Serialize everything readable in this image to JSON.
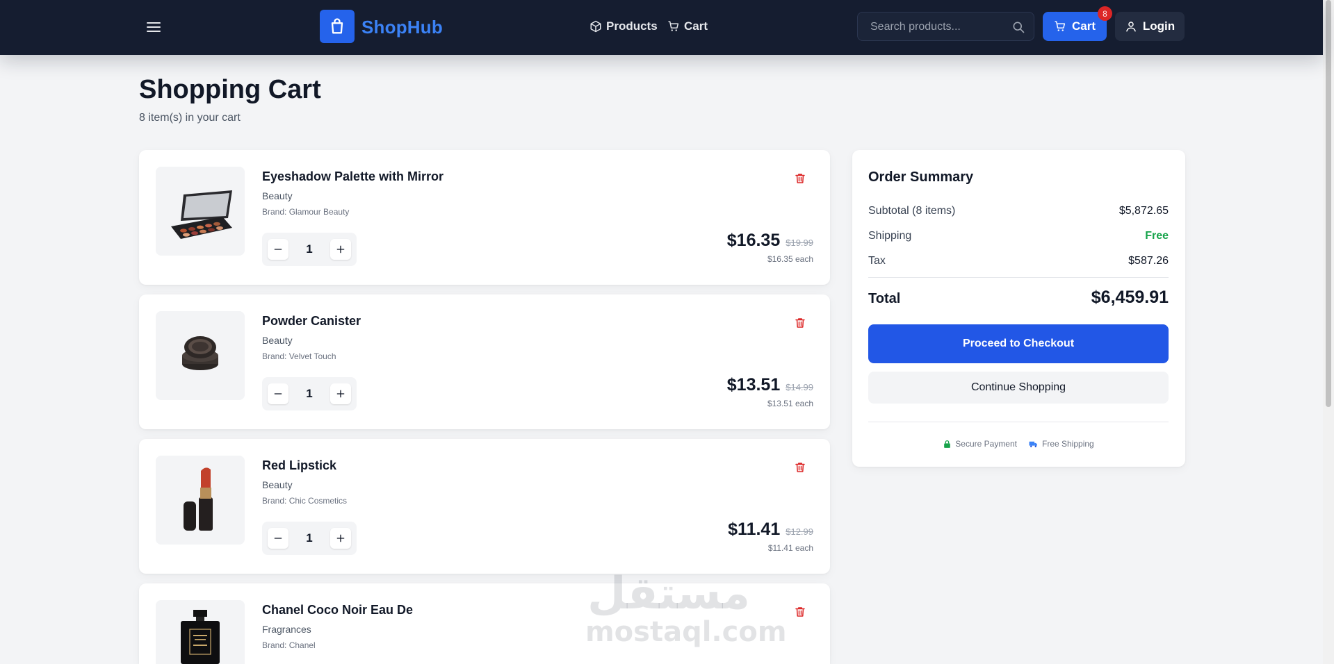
{
  "brand": {
    "name": "ShopHub"
  },
  "nav": {
    "menu_icon": "hamburger-menu-icon",
    "products_label": "Products",
    "cart_label": "Cart",
    "search_placeholder": "Search products...",
    "cart_button_label": "Cart",
    "cart_count": "8",
    "login_label": "Login"
  },
  "page": {
    "title": "Shopping Cart",
    "subtitle": "8 item(s) in your cart"
  },
  "cart_items": [
    {
      "name": "Eyeshadow Palette with Mirror",
      "category": "Beauty",
      "brand": "Brand: Glamour Beauty",
      "quantity": "1",
      "price": "$16.35",
      "original_price": "$19.99",
      "each": "$16.35 each"
    },
    {
      "name": "Powder Canister",
      "category": "Beauty",
      "brand": "Brand: Velvet Touch",
      "quantity": "1",
      "price": "$13.51",
      "original_price": "$14.99",
      "each": "$13.51 each"
    },
    {
      "name": "Red Lipstick",
      "category": "Beauty",
      "brand": "Brand: Chic Cosmetics",
      "quantity": "1",
      "price": "$11.41",
      "original_price": "$12.99",
      "each": "$11.41 each"
    },
    {
      "name": "Chanel Coco Noir Eau De",
      "category": "Fragrances",
      "brand": "Brand: Chanel",
      "quantity": "",
      "price": "",
      "original_price": "",
      "each": ""
    }
  ],
  "summary": {
    "title": "Order Summary",
    "subtotal_label": "Subtotal (8 items)",
    "subtotal_value": "$5,872.65",
    "shipping_label": "Shipping",
    "shipping_value": "Free",
    "tax_label": "Tax",
    "tax_value": "$587.26",
    "total_label": "Total",
    "total_value": "$6,459.91",
    "checkout_label": "Proceed to Checkout",
    "continue_label": "Continue Shopping",
    "secure_label": "Secure Payment",
    "free_shipping_label": "Free Shipping"
  },
  "watermark": {
    "arabic": "مستقل",
    "latin": "mostaql.com"
  },
  "colors": {
    "navbar_bg": "#151d30",
    "accent": "#2563eb",
    "delete": "#dc2626",
    "success": "#16a34a"
  }
}
